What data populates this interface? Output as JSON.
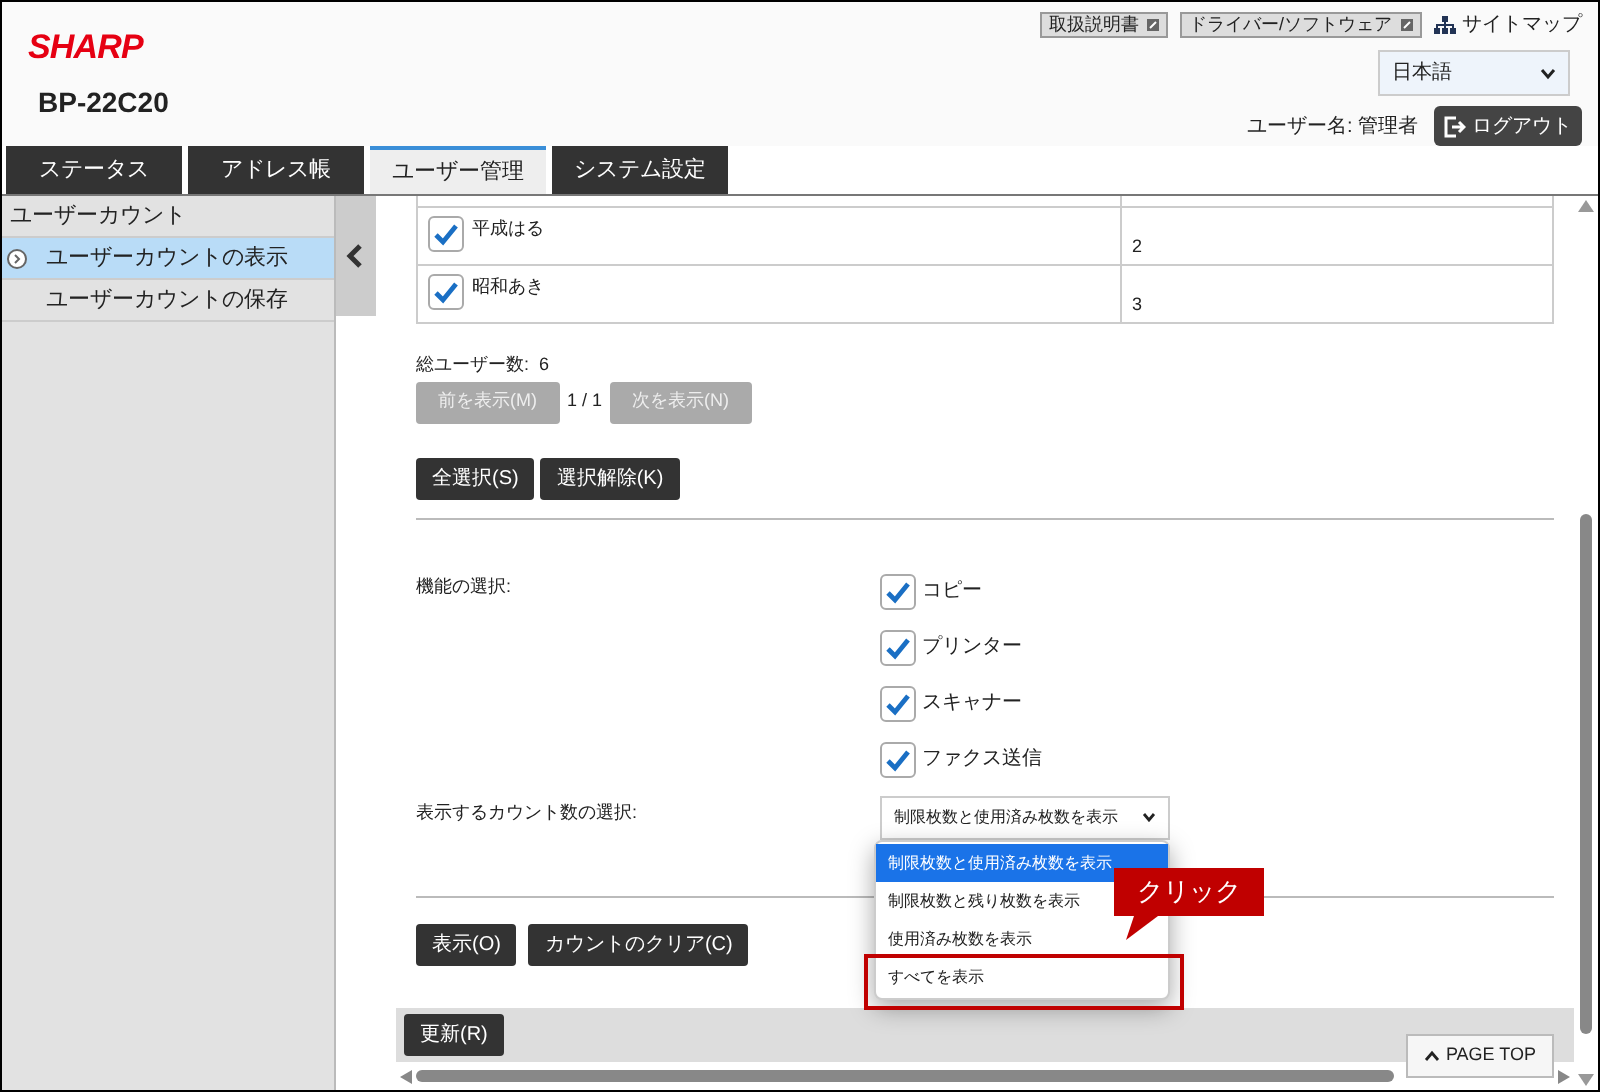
{
  "brand": {
    "logo": "SHARP",
    "model": "BP-22C20"
  },
  "top_links": [
    {
      "kind": "button",
      "label": "取扱説明書"
    },
    {
      "kind": "button",
      "label": "ドライバー/ソフトウェア"
    },
    {
      "kind": "link",
      "label": "サイトマップ"
    }
  ],
  "language": {
    "value": "日本語"
  },
  "user": {
    "label": "ユーザー名: 管理者",
    "logout": "ログアウト"
  },
  "tabs": [
    {
      "label": "ステータス",
      "selected": false
    },
    {
      "label": "アドレス帳",
      "selected": false
    },
    {
      "label": "ユーザー管理",
      "selected": true
    },
    {
      "label": "システム設定",
      "selected": false
    }
  ],
  "sidebar": {
    "items": [
      {
        "label": "ユーザーカウント",
        "selected": false,
        "children": [
          {
            "label": "ユーザーカウントの表示",
            "selected": true
          },
          {
            "label": "ユーザーカウントの保存",
            "selected": false
          }
        ]
      }
    ]
  },
  "user_table": {
    "rows": [
      {
        "name": "平成はる",
        "checked": true,
        "count": "2"
      },
      {
        "name": "昭和あき",
        "checked": true,
        "count": "3"
      }
    ]
  },
  "total_users": "総ユーザー数:  6",
  "pagination": {
    "prev": {
      "label": "前を表示(M)",
      "disabled": true
    },
    "page": "1 / 1",
    "next": {
      "label": "次を表示(N)",
      "disabled": true
    }
  },
  "select_buttons": [
    "全選択(S)",
    "選択解除(K)"
  ],
  "functions": {
    "label": "機能の選択:",
    "options": [
      {
        "label": "コピー",
        "checked": true
      },
      {
        "label": "プリンター",
        "checked": true
      },
      {
        "label": "スキャナー",
        "checked": true
      },
      {
        "label": "ファクス送信",
        "checked": true
      }
    ]
  },
  "count_select": {
    "label": "表示するカウント数の選択:",
    "value": "制限枚数と使用済み枚数を表示",
    "options": [
      {
        "label": "制限枚数と使用済み枚数を表示",
        "selected": true
      },
      {
        "label": "制限枚数と残り枚数を表示",
        "selected": false
      },
      {
        "label": "使用済み枚数を表示",
        "selected": false
      },
      {
        "label": "すべてを表示",
        "selected": false,
        "emphasized": true
      }
    ]
  },
  "action_buttons": [
    "表示(O)",
    "カウントのクリア(C)"
  ],
  "footer_button": "更新(R)",
  "page_top": "PAGE TOP",
  "callout": "クリック"
}
